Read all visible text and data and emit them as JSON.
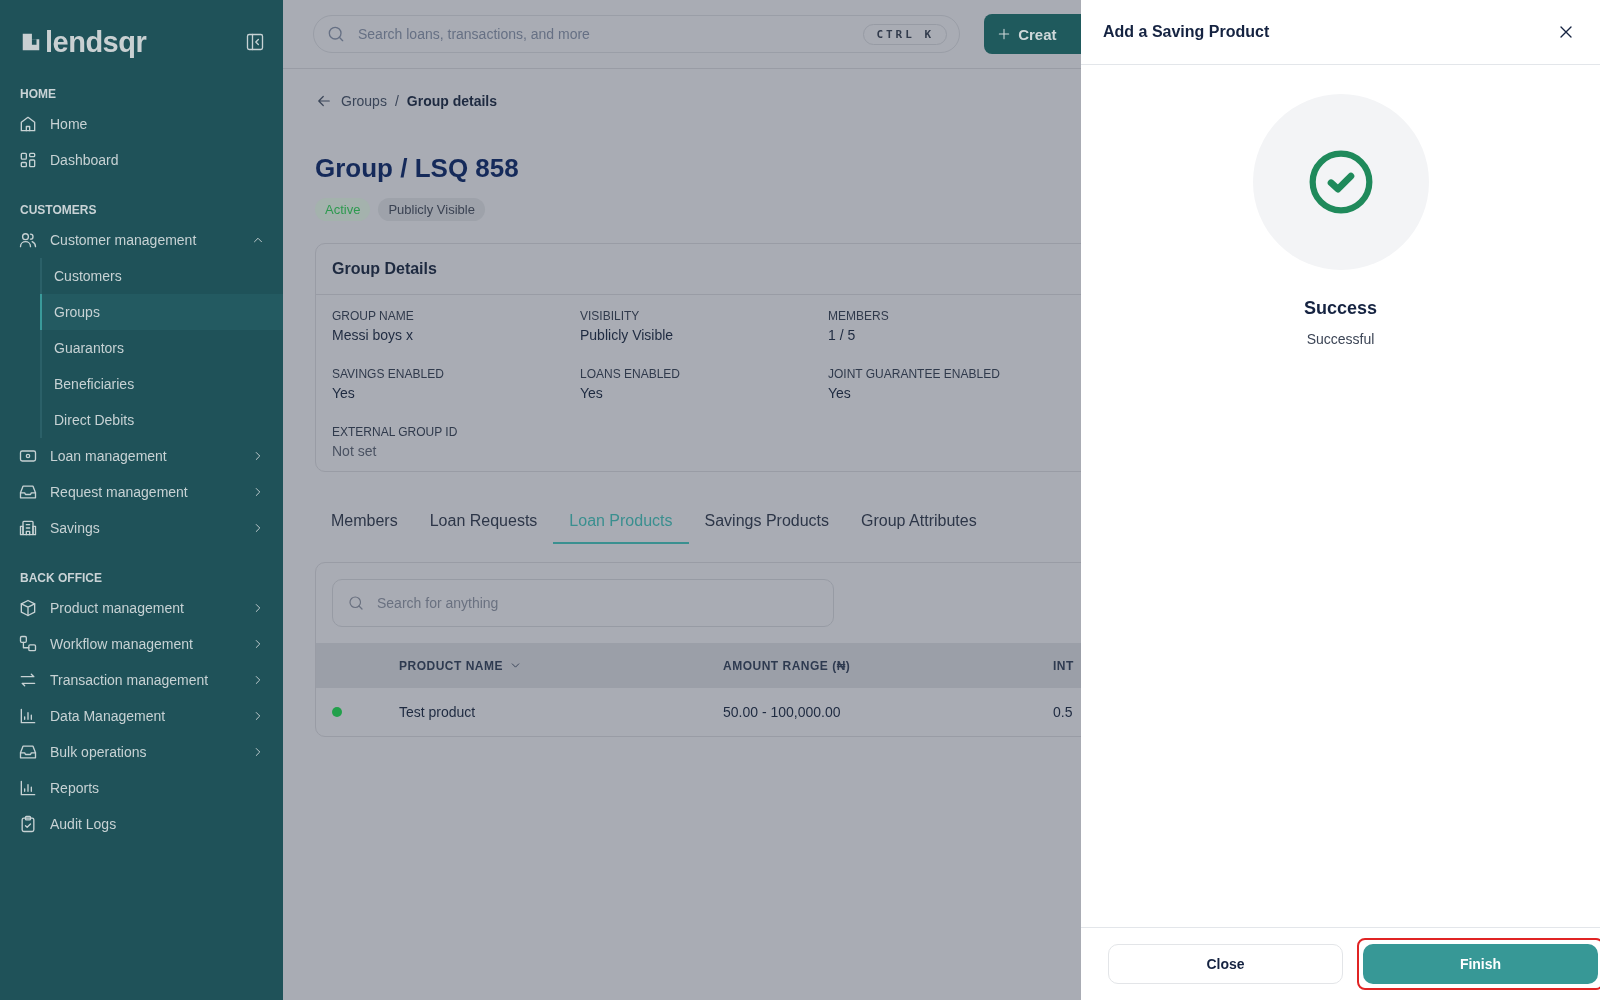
{
  "sidebar": {
    "logo": "lendsqr",
    "sections": [
      {
        "heading": "HOME",
        "items": [
          {
            "label": "Home",
            "kind": "link"
          },
          {
            "label": "Dashboard",
            "kind": "link"
          }
        ]
      },
      {
        "heading": "CUSTOMERS",
        "items": [
          {
            "label": "Customer management",
            "kind": "group",
            "expanded": true,
            "children": [
              {
                "label": "Customers",
                "selected": false
              },
              {
                "label": "Groups",
                "selected": true
              },
              {
                "label": "Guarantors",
                "selected": false
              },
              {
                "label": "Beneficiaries",
                "selected": false
              },
              {
                "label": "Direct Debits",
                "selected": false
              }
            ]
          },
          {
            "label": "Loan management",
            "kind": "group",
            "expanded": false
          },
          {
            "label": "Request management",
            "kind": "group",
            "expanded": false
          },
          {
            "label": "Savings",
            "kind": "group",
            "expanded": false
          }
        ]
      },
      {
        "heading": "BACK OFFICE",
        "items": [
          {
            "label": "Product management",
            "kind": "group",
            "expanded": false
          },
          {
            "label": "Workflow management",
            "kind": "group",
            "expanded": false
          },
          {
            "label": "Transaction management",
            "kind": "group",
            "expanded": false
          },
          {
            "label": "Data Management",
            "kind": "group",
            "expanded": false
          },
          {
            "label": "Bulk operations",
            "kind": "group",
            "expanded": false
          },
          {
            "label": "Reports",
            "kind": "link"
          },
          {
            "label": "Audit Logs",
            "kind": "link"
          }
        ]
      }
    ]
  },
  "topbar": {
    "search": {
      "placeholder": "Search loans, transactions, and more"
    },
    "shortcut": "CTRL K",
    "create_button": "Creat"
  },
  "page": {
    "breadcrumb": [
      "Groups",
      "Group details"
    ],
    "breadcrumb_separator": "/",
    "title": "Group / LSQ 858",
    "badges": [
      {
        "label": "Active",
        "kind": "status"
      },
      {
        "label": "Publicly Visible",
        "kind": "neutral"
      }
    ],
    "details": {
      "title": "Group Details",
      "fields": [
        {
          "label": "GROUP NAME",
          "value": "Messi boys x",
          "empty": false
        },
        {
          "label": "VISIBILITY",
          "value": "Publicly Visible",
          "empty": false
        },
        {
          "label": "MEMBERS",
          "value": "1 / 5",
          "empty": false
        },
        {
          "label": "SAVINGS ENABLED",
          "value": "Yes",
          "empty": false
        },
        {
          "label": "LOANS ENABLED",
          "value": "Yes",
          "empty": false
        },
        {
          "label": "JOINT GUARANTEE ENABLED",
          "value": "Yes",
          "empty": false
        },
        {
          "label": "EXTERNAL GROUP ID",
          "value": "Not set",
          "empty": true
        }
      ]
    },
    "tabs": [
      {
        "label": "Members",
        "selected": false
      },
      {
        "label": "Loan Requests",
        "selected": false
      },
      {
        "label": "Loan Products",
        "selected": true
      },
      {
        "label": "Savings Products",
        "selected": false
      },
      {
        "label": "Group Attributes",
        "selected": false
      }
    ],
    "table": {
      "search": {
        "placeholder": "Search for anything"
      },
      "columns": [
        {
          "label": "PRODUCT NAME",
          "sortable": true
        },
        {
          "label": "AMOUNT RANGE (₦)",
          "sortable": false
        },
        {
          "label": "INT",
          "sortable": false
        }
      ],
      "rows": [
        {
          "color": "#22a04b",
          "cells": [
            "Test product",
            "50.00 - 100,000.00",
            "0.5"
          ]
        }
      ]
    }
  },
  "drawer": {
    "title": "Add a Saving Product",
    "status": "Success",
    "message": "Successful",
    "buttons": [
      {
        "label": "Close",
        "kind": "secondary",
        "highlighted": false
      },
      {
        "label": "Finish",
        "kind": "primary",
        "highlighted": true
      }
    ]
  }
}
